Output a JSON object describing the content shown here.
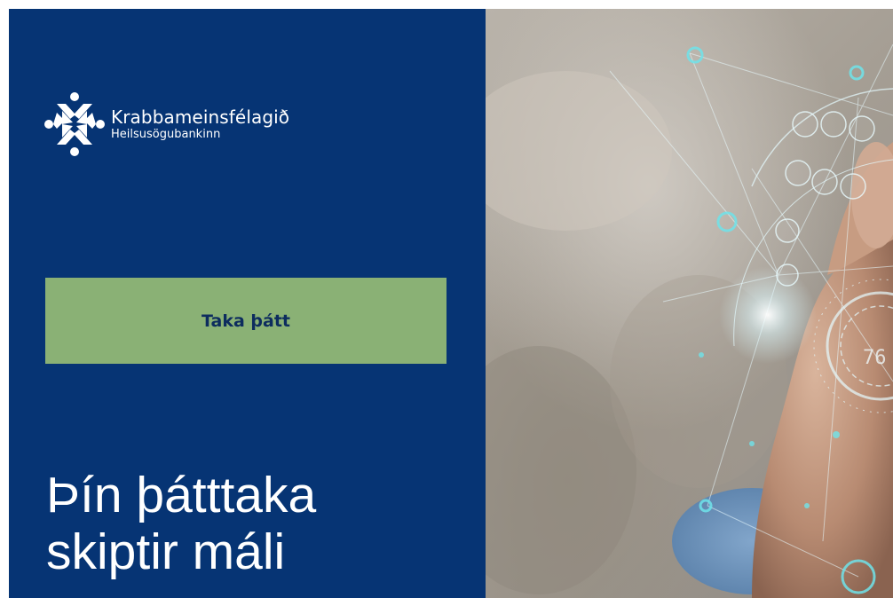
{
  "brand": {
    "name": "Krabbameinsfélagið",
    "subtitle": "Heilsusögubankinn",
    "logo_icon": "krabbameinsfelagid-logo-icon"
  },
  "cta": {
    "label": "Taka þátt"
  },
  "headline": {
    "line1": "Þín þátttaka",
    "line2": "skiptir máli"
  },
  "hero": {
    "image": "hand-touching-digital-network-photo",
    "readout": "76"
  },
  "colors": {
    "panel_background": "#063474",
    "cta_background": "#8ab175",
    "cta_text": "#0d2c5e",
    "headline_text": "#ffffff",
    "accent_glow": "#6fe3ea"
  }
}
